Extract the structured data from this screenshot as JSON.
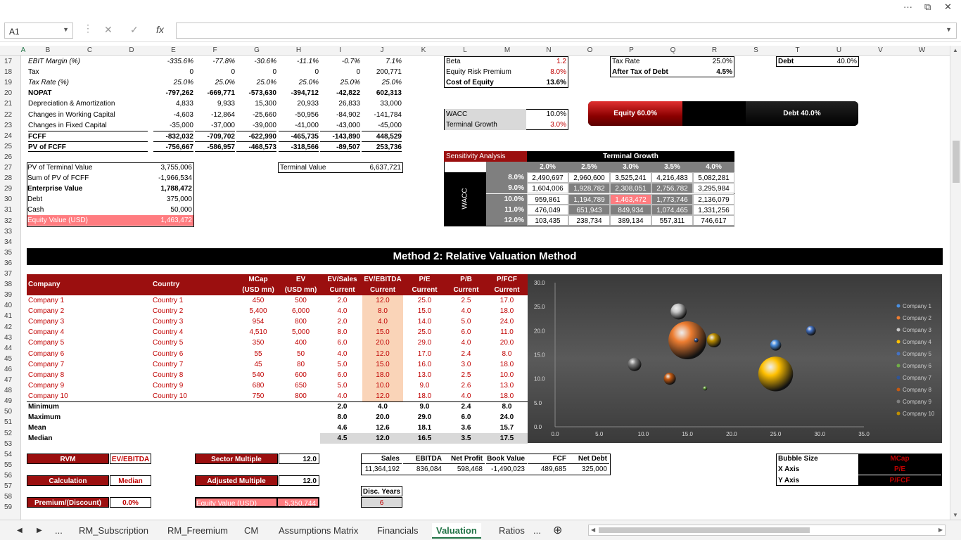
{
  "formula_bar": {
    "name_box": "A1",
    "formula": ""
  },
  "columns": [
    "A",
    "B",
    "C",
    "D",
    "E",
    "F",
    "G",
    "H",
    "I",
    "J",
    "K",
    "L",
    "M",
    "N",
    "O",
    "P",
    "Q",
    "R",
    "S",
    "T",
    "U",
    "V",
    "W"
  ],
  "rows": [
    "17",
    "18",
    "19",
    "20",
    "21",
    "22",
    "23",
    "24",
    "25",
    "26",
    "27",
    "28",
    "29",
    "30",
    "31",
    "32",
    "33",
    "34",
    "35",
    "36",
    "37",
    "38",
    "39",
    "40",
    "41",
    "42",
    "43",
    "44",
    "45",
    "46",
    "47",
    "48",
    "49",
    "50",
    "51",
    "52",
    "53",
    "54",
    "55",
    "56",
    "57",
    "58",
    "59"
  ],
  "fcff": [
    {
      "label": "EBIT Margin (%)",
      "style": "i",
      "vals": [
        "-335.6%",
        "-77.8%",
        "-30.6%",
        "-11.1%",
        "-0.7%",
        "7.1%"
      ]
    },
    {
      "label": "Tax",
      "style": "",
      "vals": [
        "0",
        "0",
        "0",
        "0",
        "0",
        "200,771"
      ]
    },
    {
      "label": "Tax Rate (%)",
      "style": "i",
      "vals": [
        "25.0%",
        "25.0%",
        "25.0%",
        "25.0%",
        "25.0%",
        "25.0%"
      ]
    },
    {
      "label": "NOPAT",
      "style": "b",
      "vals": [
        "-797,262",
        "-669,771",
        "-573,630",
        "-394,712",
        "-42,822",
        "602,313"
      ]
    },
    {
      "label": "Depreciation & Amortization",
      "style": "",
      "vals": [
        "4,833",
        "9,933",
        "15,300",
        "20,933",
        "26,833",
        "33,000"
      ]
    },
    {
      "label": "Changes in Working Capital",
      "style": "",
      "vals": [
        "-4,603",
        "-12,864",
        "-25,660",
        "-50,956",
        "-84,902",
        "-141,784"
      ]
    },
    {
      "label": "Changes in Fixed Capital",
      "style": "",
      "vals": [
        "-35,000",
        "-37,000",
        "-39,000",
        "-41,000",
        "-43,000",
        "-45,000"
      ]
    },
    {
      "label": "FCFF",
      "style": "b",
      "vals": [
        "-832,032",
        "-709,702",
        "-622,990",
        "-465,735",
        "-143,890",
        "448,529"
      ]
    },
    {
      "label": "PV of FCFF",
      "style": "b",
      "vals": [
        "-756,667",
        "-586,957",
        "-468,573",
        "-318,566",
        "-89,507",
        "253,736"
      ]
    }
  ],
  "ev_box": [
    {
      "label": "PV of Terminal Value",
      "val": "3,755,006"
    },
    {
      "label": "Sum of PV of FCFF",
      "val": "-1,966,534"
    },
    {
      "label": "Enterprise Value",
      "val": "1,788,472"
    },
    {
      "label": "Debt",
      "val": "375,000"
    },
    {
      "label": "Cash",
      "val": "50,000"
    },
    {
      "label": "Equity Value (USD)",
      "val": "1,463,472"
    }
  ],
  "terminal_value": {
    "label": "Terminal Value",
    "val": "6,637,721"
  },
  "coe": [
    {
      "label": "Beta",
      "val": "1.2"
    },
    {
      "label": "Equity Risk Premium",
      "val": "8.0%"
    },
    {
      "label": "Cost of Equity",
      "val": "13.6%"
    }
  ],
  "tax": [
    {
      "label": "Tax Rate",
      "val": "25.0%"
    },
    {
      "label": "After Tax of Debt",
      "val": "4.5%"
    }
  ],
  "debt_weight": {
    "label": "Debt",
    "val": "40.0%"
  },
  "wacc_box": [
    {
      "label": "WACC",
      "val": "10.0%"
    },
    {
      "label": "Terminal Growth",
      "val": "3.0%"
    }
  ],
  "capsule": {
    "equity": "Equity 60.0%",
    "debt": "Debt 40.0%",
    "equity_frac": 0.6
  },
  "sensitivity": {
    "title": "Sensitivity Analysis",
    "col_title": "Terminal Growth",
    "row_title": "WACC",
    "cols": [
      "2.0%",
      "2.5%",
      "3.0%",
      "3.5%",
      "4.0%"
    ],
    "rows": [
      {
        "h": "8.0%",
        "v": [
          "2,490,697",
          "2,960,600",
          "3,525,241",
          "4,216,483",
          "5,082,281"
        ]
      },
      {
        "h": "9.0%",
        "v": [
          "1,604,006",
          "1,928,782",
          "2,308,051",
          "2,756,782",
          "3,295,984"
        ]
      },
      {
        "h": "10.0%",
        "v": [
          "959,861",
          "1,194,789",
          "1,463,472",
          "1,773,746",
          "2,136,079"
        ]
      },
      {
        "h": "11.0%",
        "v": [
          "476,049",
          "651,943",
          "849,934",
          "1,074,465",
          "1,331,256"
        ]
      },
      {
        "h": "12.0%",
        "v": [
          "103,435",
          "238,734",
          "389,134",
          "557,311",
          "746,617"
        ]
      }
    ]
  },
  "banner": "Method 2: Relative Valuation Method",
  "comps": {
    "headers1": [
      "Company",
      "Country",
      "MCap",
      "EV",
      "EV/Sales",
      "EV/EBITDA",
      "P/E",
      "P/B",
      "P/FCF"
    ],
    "headers2": [
      "(USD mn)",
      "(USD mn)",
      "Current",
      "Current",
      "Current",
      "Current",
      "Current"
    ],
    "rows": [
      [
        "Company 1",
        "Country 1",
        "450",
        "500",
        "2.0",
        "12.0",
        "25.0",
        "2.5",
        "17.0"
      ],
      [
        "Company 2",
        "Country 2",
        "5,400",
        "6,000",
        "4.0",
        "8.0",
        "15.0",
        "4.0",
        "18.0"
      ],
      [
        "Company 3",
        "Country 3",
        "954",
        "800",
        "2.0",
        "4.0",
        "14.0",
        "5.0",
        "24.0"
      ],
      [
        "Company 4",
        "Country 4",
        "4,510",
        "5,000",
        "8.0",
        "15.0",
        "25.0",
        "6.0",
        "11.0"
      ],
      [
        "Company 5",
        "Country 5",
        "350",
        "400",
        "6.0",
        "20.0",
        "29.0",
        "4.0",
        "20.0"
      ],
      [
        "Company 6",
        "Country 6",
        "55",
        "50",
        "4.0",
        "12.0",
        "17.0",
        "2.4",
        "8.0"
      ],
      [
        "Company 7",
        "Country 7",
        "45",
        "80",
        "5.0",
        "15.0",
        "16.0",
        "3.0",
        "18.0"
      ],
      [
        "Company 8",
        "Country 8",
        "540",
        "600",
        "6.0",
        "18.0",
        "13.0",
        "2.5",
        "10.0"
      ],
      [
        "Company 9",
        "Country 9",
        "680",
        "650",
        "5.0",
        "10.0",
        "9.0",
        "2.6",
        "13.0"
      ],
      [
        "Company 10",
        "Country 10",
        "750",
        "800",
        "4.0",
        "12.0",
        "18.0",
        "4.0",
        "18.0"
      ]
    ],
    "stats": [
      {
        "label": "Minimum",
        "v": [
          "2.0",
          "4.0",
          "9.0",
          "2.4",
          "8.0"
        ]
      },
      {
        "label": "Maximum",
        "v": [
          "8.0",
          "20.0",
          "29.0",
          "6.0",
          "24.0"
        ]
      },
      {
        "label": "Mean",
        "v": [
          "4.6",
          "12.6",
          "18.1",
          "3.6",
          "15.7"
        ]
      },
      {
        "label": "Median",
        "v": [
          "4.5",
          "12.0",
          "16.5",
          "3.5",
          "17.5"
        ]
      }
    ]
  },
  "controls": {
    "rvm_label": "RVM",
    "rvm_val": "EV/EBITDA",
    "calc_label": "Calculation",
    "calc_val": "Median",
    "prem_label": "Premium/(Discount)",
    "prem_val": "0.0%",
    "sector_label": "Sector Multiple",
    "sector_val": "12.0",
    "adj_label": "Adjusted Multiple",
    "adj_val": "12.0",
    "eq_label": "Equity Value (USD)",
    "eq_val": "5,350,744"
  },
  "fin": {
    "headers": [
      "Sales",
      "EBITDA",
      "Net Profit",
      "Book Value",
      "FCF",
      "Net Debt"
    ],
    "vals": [
      "11,364,192",
      "836,084",
      "598,468",
      "-1,490,023",
      "489,685",
      "325,000"
    ],
    "disc_label": "Disc. Years",
    "disc_val": "6"
  },
  "bubble_cfg": [
    {
      "label": "Bubble Size",
      "val": "MCap"
    },
    {
      "label": "X Axis",
      "val": "P/E"
    },
    {
      "label": "Y Axis",
      "val": "P/FCF"
    }
  ],
  "chart_data": {
    "type": "scatter",
    "title": "",
    "xlabel": "",
    "ylabel": "",
    "xlim": [
      0,
      35
    ],
    "ylim": [
      0,
      30
    ],
    "xticks": [
      "0.0",
      "5.0",
      "10.0",
      "15.0",
      "20.0",
      "25.0",
      "30.0",
      "35.0"
    ],
    "yticks": [
      "0.0",
      "5.0",
      "10.0",
      "15.0",
      "20.0",
      "25.0",
      "30.0"
    ],
    "legend": "right",
    "series": [
      {
        "name": "Company 1",
        "x": 25,
        "y": 17,
        "size": 450,
        "color": "#4a90e2"
      },
      {
        "name": "Company 2",
        "x": 15,
        "y": 18,
        "size": 5400,
        "color": "#ed7d31"
      },
      {
        "name": "Company 3",
        "x": 14,
        "y": 24,
        "size": 954,
        "color": "#c8c8c8"
      },
      {
        "name": "Company 4",
        "x": 25,
        "y": 11,
        "size": 4510,
        "color": "#ffc000"
      },
      {
        "name": "Company 5",
        "x": 29,
        "y": 20,
        "size": 350,
        "color": "#4472c4"
      },
      {
        "name": "Company 6",
        "x": 17,
        "y": 8,
        "size": 55,
        "color": "#70ad47"
      },
      {
        "name": "Company 7",
        "x": 16,
        "y": 18,
        "size": 45,
        "color": "#2f5597"
      },
      {
        "name": "Company 8",
        "x": 13,
        "y": 10,
        "size": 540,
        "color": "#c55a11"
      },
      {
        "name": "Company 9",
        "x": 9,
        "y": 13,
        "size": 680,
        "color": "#7f7f7f"
      },
      {
        "name": "Company 10",
        "x": 18,
        "y": 18,
        "size": 750,
        "color": "#bf8f00"
      }
    ]
  },
  "tabs": [
    "...",
    "RM_Subscription",
    "RM_Freemium",
    "CM",
    "Assumptions Matrix",
    "Financials",
    "Valuation",
    "Ratios",
    "..."
  ],
  "active_tab": "Valuation"
}
